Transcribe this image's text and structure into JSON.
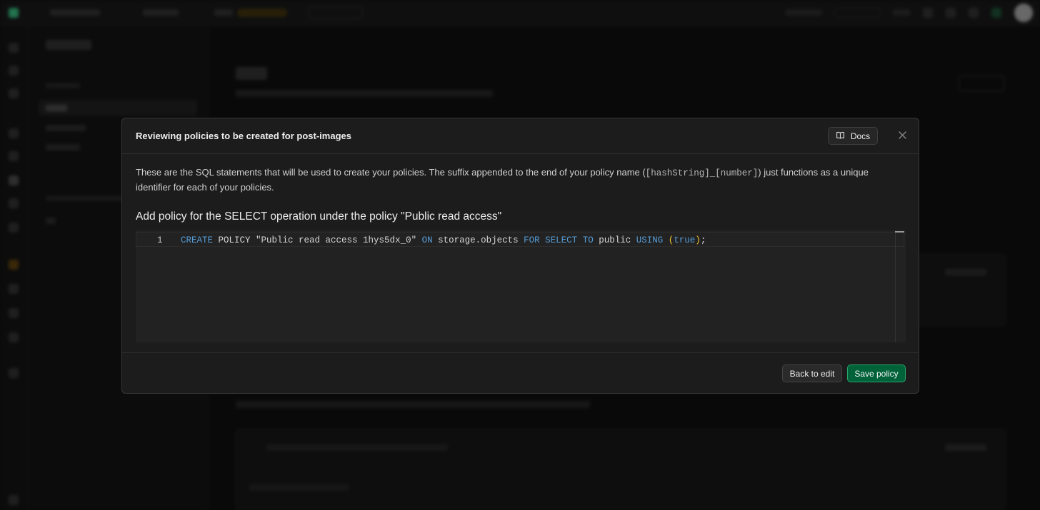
{
  "modal": {
    "title": "Reviewing policies to be created for post-images",
    "docs_label": "Docs",
    "description_before": "These are the SQL statements that will be used to create your policies. The suffix appended to the end of your policy name (",
    "description_code": "[hashString]_[number]",
    "description_after": ") just functions as a unique identifier for each of your policies.",
    "policy_heading": "Add policy for the SELECT operation under the policy \"Public read access\"",
    "editor": {
      "line_number": "1",
      "tokens": {
        "create": "CREATE",
        "policy": " POLICY ",
        "name": "\"Public read access 1hys5dx_0\"",
        "on": "ON",
        "target": " storage.objects ",
        "for": "FOR",
        "select": "SELECT",
        "to": "TO",
        "role": " public ",
        "using": "USING",
        "open_paren": "(",
        "value": "true",
        "close_paren": ")",
        "semicolon": ";"
      }
    },
    "back_label": "Back to edit",
    "save_label": "Save policy"
  },
  "colors": {
    "accent_green": "#006239",
    "keyword_blue": "#569cd6",
    "paren_yellow": "#f1c232",
    "modal_bg": "#1c1c1c"
  }
}
